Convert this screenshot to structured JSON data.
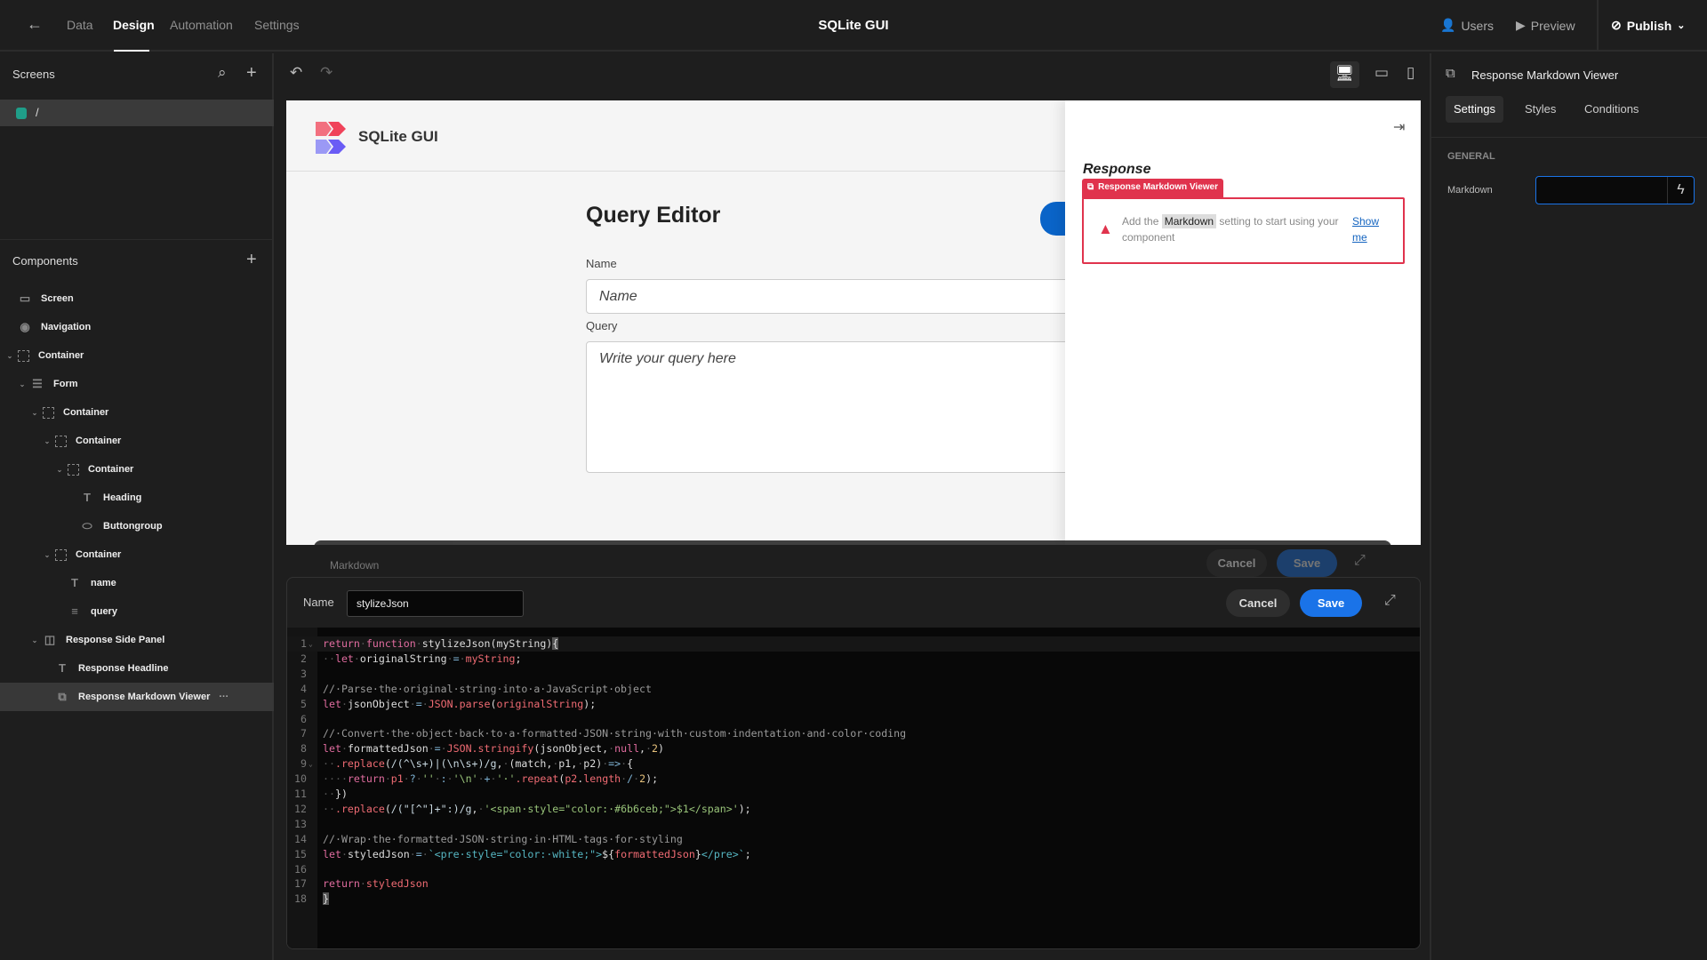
{
  "topbar": {
    "nav": [
      "Data",
      "Design",
      "Automation",
      "Settings"
    ],
    "active": "Design",
    "title": "SQLite GUI",
    "users": "Users",
    "preview": "Preview",
    "publish": "Publish"
  },
  "screens": {
    "title": "Screens",
    "items": [
      {
        "label": "/",
        "color": "#1f9e89"
      }
    ]
  },
  "components": {
    "title": "Components",
    "items": [
      {
        "label": "Screen",
        "icon": "screen-icon",
        "depth": 0,
        "chev": false
      },
      {
        "label": "Navigation",
        "icon": "eye-icon",
        "depth": 0,
        "chev": false
      },
      {
        "label": "Container",
        "icon": "container-icon",
        "depth": 0,
        "chev": true
      },
      {
        "label": "Form",
        "icon": "form-icon",
        "depth": 1,
        "chev": true
      },
      {
        "label": "Container",
        "icon": "container-icon",
        "depth": 2,
        "chev": true
      },
      {
        "label": "Container",
        "icon": "container-icon",
        "depth": 3,
        "chev": true
      },
      {
        "label": "Container",
        "icon": "container-icon",
        "depth": 4,
        "chev": true
      },
      {
        "label": "Heading",
        "icon": "text-icon",
        "depth": 5,
        "chev": false
      },
      {
        "label": "Buttongroup",
        "icon": "button-icon",
        "depth": 5,
        "chev": false
      },
      {
        "label": "Container",
        "icon": "container-icon",
        "depth": 3,
        "chev": true
      },
      {
        "label": "name",
        "icon": "text-icon",
        "depth": 4,
        "chev": false
      },
      {
        "label": "query",
        "icon": "textarea-icon",
        "depth": 4,
        "chev": false
      },
      {
        "label": "Response Side Panel",
        "icon": "side-panel-icon",
        "depth": 2,
        "chev": true
      },
      {
        "label": "Response Headline",
        "icon": "text-icon",
        "depth": 3,
        "chev": false
      },
      {
        "label": "Response Markdown Viewer",
        "icon": "markdown-viewer-icon",
        "depth": 3,
        "chev": false,
        "selected": true
      }
    ]
  },
  "app": {
    "name": "SQLite GUI",
    "heading": "Query Editor",
    "name_label": "Name",
    "name_placeholder": "Name",
    "query_label": "Query",
    "query_placeholder": "Write your query here"
  },
  "side_panel": {
    "headline": "Response",
    "tag": "Response Markdown Viewer",
    "alert_pre": "Add the",
    "alert_key": "Markdown",
    "alert_post": "setting to start using your component",
    "alert_link": "Show me"
  },
  "props": {
    "title": "Response Markdown Viewer",
    "tabs": [
      "Settings",
      "Styles",
      "Conditions"
    ],
    "active_tab": "Settings",
    "section": "GENERAL",
    "markdown_label": "Markdown",
    "markdown_value": ""
  },
  "modal_back": {
    "label": "Markdown",
    "cancel": "Cancel",
    "save": "Save"
  },
  "modal": {
    "name_label": "Name",
    "name_value": "stylizeJson",
    "cancel": "Cancel",
    "save": "Save",
    "lines": [
      [
        [
          "kw",
          "return"
        ],
        [
          "ws",
          "·"
        ],
        [
          "kw",
          "function"
        ],
        [
          "ws",
          "·"
        ],
        [
          "id",
          "stylizeJson(myString)"
        ],
        [
          "curb",
          "{"
        ]
      ],
      [
        [
          "ws",
          "··"
        ],
        [
          "kw",
          "let"
        ],
        [
          "ws",
          "·"
        ],
        [
          "id",
          "originalString"
        ],
        [
          "ws",
          "·"
        ],
        [
          "op",
          "="
        ],
        [
          "ws",
          "·"
        ],
        [
          "var",
          "myString"
        ],
        [
          "id",
          ";"
        ]
      ],
      [],
      [
        [
          "cm",
          "//·Parse·the·original·string·into·a·JavaScript·object"
        ]
      ],
      [
        [
          "kw",
          "let"
        ],
        [
          "ws",
          "·"
        ],
        [
          "id",
          "jsonObject"
        ],
        [
          "ws",
          "·"
        ],
        [
          "op",
          "="
        ],
        [
          "ws",
          "·"
        ],
        [
          "fn",
          "JSON.parse"
        ],
        [
          "id",
          "("
        ],
        [
          "var",
          "originalString"
        ],
        [
          "id",
          ");"
        ]
      ],
      [],
      [
        [
          "cm",
          "//·Convert·the·object·back·to·a·formatted·JSON·string·with·custom·indentation·and·color·coding"
        ]
      ],
      [
        [
          "kw",
          "let"
        ],
        [
          "ws",
          "·"
        ],
        [
          "id",
          "formattedJson"
        ],
        [
          "ws",
          "·"
        ],
        [
          "op",
          "="
        ],
        [
          "ws",
          "·"
        ],
        [
          "fn",
          "JSON.stringify"
        ],
        [
          "id",
          "(jsonObject,"
        ],
        [
          "ws",
          "·"
        ],
        [
          "kw",
          "null"
        ],
        [
          "id",
          ","
        ],
        [
          "ws",
          "·"
        ],
        [
          "num",
          "2"
        ],
        [
          "id",
          ")"
        ]
      ],
      [
        [
          "ws",
          "··"
        ],
        [
          "fn",
          ".replace"
        ],
        [
          "id",
          "("
        ],
        [
          "rx",
          "/(^\\s+)|(\\n\\s+)/g"
        ],
        [
          "id",
          ","
        ],
        [
          "ws",
          "·"
        ],
        [
          "id",
          "(match,"
        ],
        [
          "ws",
          "·"
        ],
        [
          "id",
          "p1,"
        ],
        [
          "ws",
          "·"
        ],
        [
          "id",
          "p2)"
        ],
        [
          "ws",
          "·"
        ],
        [
          "op",
          "=>"
        ],
        [
          "ws",
          "·"
        ],
        [
          "id",
          "{"
        ]
      ],
      [
        [
          "ws",
          "····"
        ],
        [
          "kw",
          "return"
        ],
        [
          "ws",
          "·"
        ],
        [
          "var",
          "p1"
        ],
        [
          "ws",
          "·"
        ],
        [
          "op",
          "?"
        ],
        [
          "ws",
          "·"
        ],
        [
          "str",
          "''"
        ],
        [
          "ws",
          "·"
        ],
        [
          "op",
          ":"
        ],
        [
          "ws",
          "·"
        ],
        [
          "str",
          "'\\n'"
        ],
        [
          "ws",
          "·"
        ],
        [
          "op",
          "+"
        ],
        [
          "ws",
          "·"
        ],
        [
          "str",
          "'·'"
        ],
        [
          "fn",
          ".repeat"
        ],
        [
          "id",
          "("
        ],
        [
          "var",
          "p2"
        ],
        [
          "id",
          "."
        ],
        [
          "var",
          "length"
        ],
        [
          "ws",
          "·"
        ],
        [
          "op",
          "/"
        ],
        [
          "ws",
          "·"
        ],
        [
          "num",
          "2"
        ],
        [
          "id",
          ");"
        ]
      ],
      [
        [
          "ws",
          "··"
        ],
        [
          "id",
          "})"
        ]
      ],
      [
        [
          "ws",
          "··"
        ],
        [
          "fn",
          ".replace"
        ],
        [
          "id",
          "("
        ],
        [
          "rx",
          "/(\"[^\"]+\":)/g"
        ],
        [
          "id",
          ","
        ],
        [
          "ws",
          "·"
        ],
        [
          "str",
          "'<span·style=\"color:·#6b6ceb;\">$1</span>'"
        ],
        [
          "id",
          ");"
        ]
      ],
      [],
      [
        [
          "cm",
          "//·Wrap·the·formatted·JSON·string·in·HTML·tags·for·styling"
        ]
      ],
      [
        [
          "kw",
          "let"
        ],
        [
          "ws",
          "·"
        ],
        [
          "id",
          "styledJson"
        ],
        [
          "ws",
          "·"
        ],
        [
          "op",
          "="
        ],
        [
          "ws",
          "·"
        ],
        [
          "tpl",
          "`<pre·style=\"color:·white;\">"
        ],
        [
          "id",
          "${"
        ],
        [
          "var",
          "formattedJson"
        ],
        [
          "id",
          "}"
        ],
        [
          "tpl",
          "</pre>`"
        ],
        [
          "id",
          ";"
        ]
      ],
      [],
      [
        [
          "kw",
          "return"
        ],
        [
          "ws",
          "·"
        ],
        [
          "var",
          "styledJson"
        ]
      ],
      [
        [
          "curb",
          "}"
        ]
      ]
    ],
    "folds": [
      1,
      9
    ]
  },
  "colors": {
    "accent": "#1a73e8",
    "error": "#e0334d",
    "logo_top": "#f0435a",
    "logo_bottom": "#6a5cf5"
  }
}
